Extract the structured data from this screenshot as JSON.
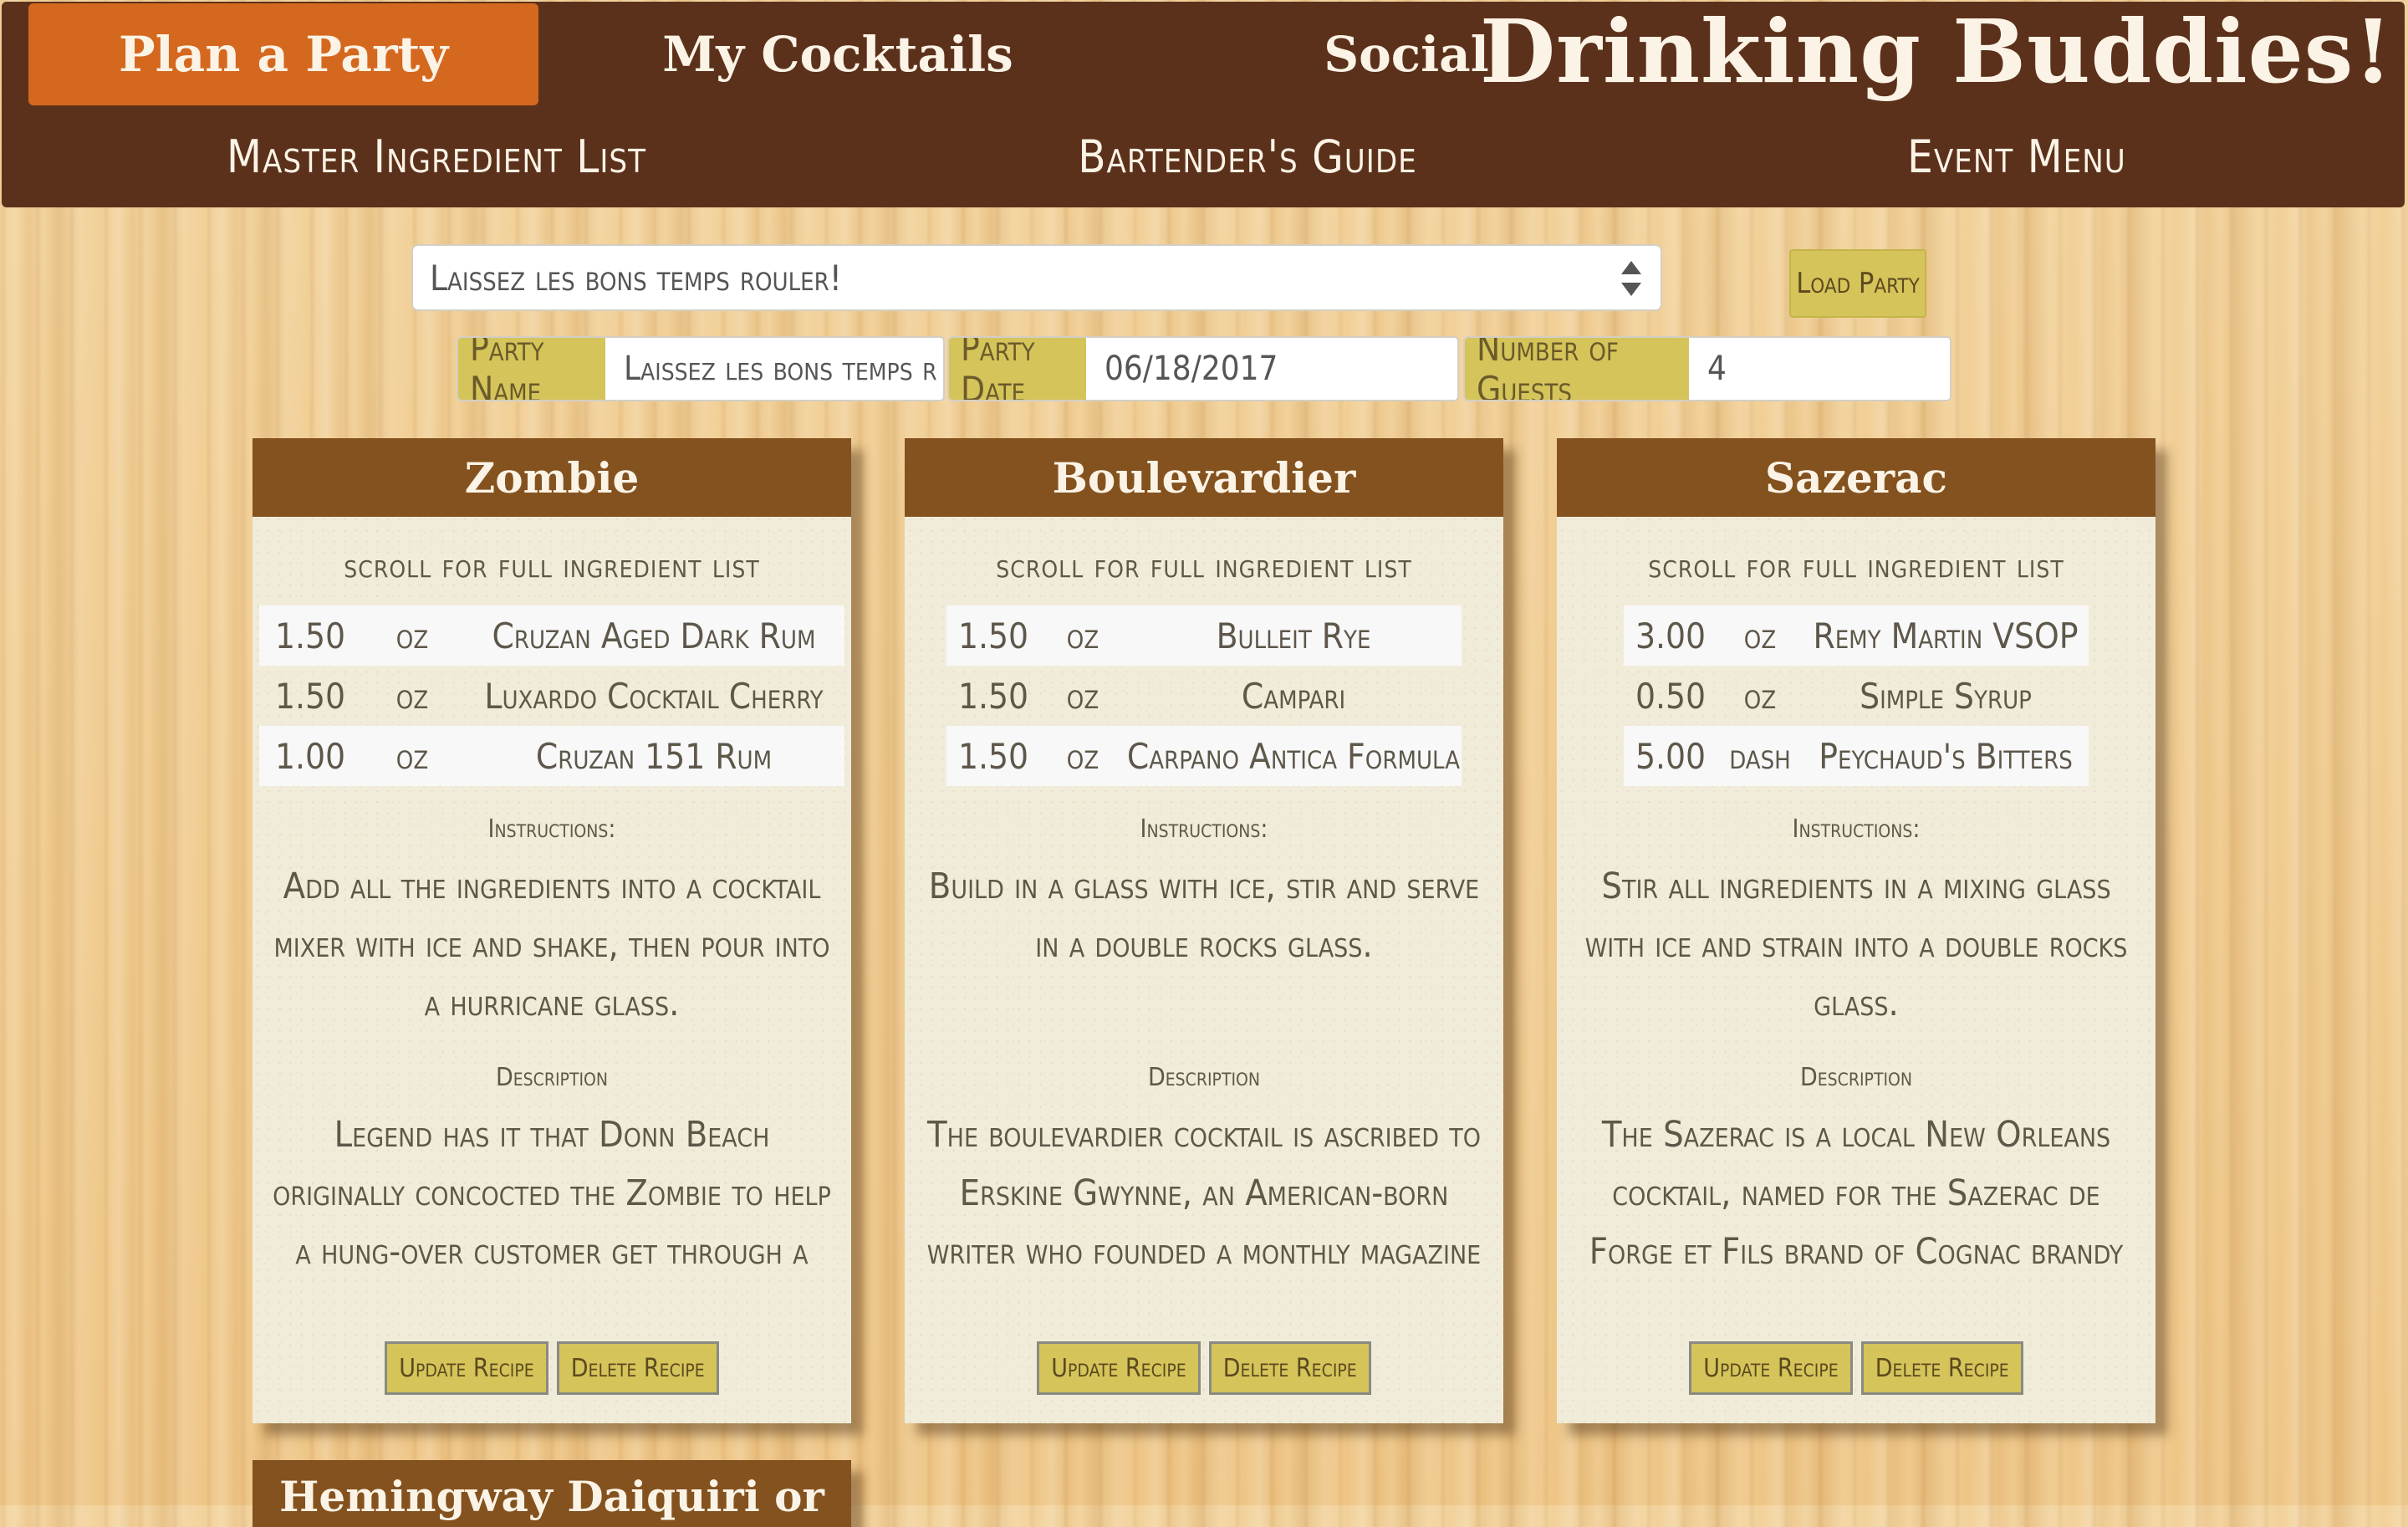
{
  "header": {
    "tabs": [
      "Plan a Party",
      "My Cocktails",
      "Social"
    ],
    "brand": "Drinking Buddies!",
    "subnav": [
      "Master Ingredient List",
      "Bartender's Guide",
      "Event Menu"
    ]
  },
  "party": {
    "selected": "Laissez les bons temps rouler!",
    "load_label": "Load Party",
    "name_label": "Party Name",
    "name_value": "Laissez les bons temps r",
    "date_label": "Party Date",
    "date_value": "06/18/2017",
    "guests_label": "Number of Guests",
    "guests_value": "4"
  },
  "cards": [
    {
      "title": "Zombie",
      "scroll_note": "scroll for full ingredient list",
      "ingredients": [
        {
          "amount": "1.50",
          "unit": "oz",
          "name": "Cruzan Aged Dark Rum"
        },
        {
          "amount": "1.50",
          "unit": "oz",
          "name": "Luxardo Cocktail Cherry"
        },
        {
          "amount": "1.00",
          "unit": "oz",
          "name": "Cruzan 151 Rum"
        }
      ],
      "instructions_label": "Instructions:",
      "instructions": "Add all the ingredients into a cocktail mixer with ice and shake, then pour into a hurricane glass.",
      "description_label": "Description",
      "description": "Legend has it that Donn Beach originally concocted the Zombie to help a hung-over customer get through a business meeting. The",
      "update_label": "Update Recipe",
      "delete_label": "Delete Recipe"
    },
    {
      "title": "Boulevardier",
      "scroll_note": "scroll for full ingredient list",
      "ingredients": [
        {
          "amount": "1.50",
          "unit": "oz",
          "name": "Bulleit Rye"
        },
        {
          "amount": "1.50",
          "unit": "oz",
          "name": "Campari"
        },
        {
          "amount": "1.50",
          "unit": "oz",
          "name": "Carpano Antica Formula"
        }
      ],
      "instructions_label": "Instructions:",
      "instructions": "Build in a glass with ice, stir and serve in a double rocks glass.",
      "description_label": "Description",
      "description": "The boulevardier cocktail is ascribed to Erskine Gwynne, an American-born writer who founded a monthly magazine in Paris called Boulevardier,",
      "update_label": "Update Recipe",
      "delete_label": "Delete Recipe"
    },
    {
      "title": "Sazerac",
      "scroll_note": "scroll for full ingredient list",
      "ingredients": [
        {
          "amount": "3.00",
          "unit": "oz",
          "name": "Remy Martin VSOP"
        },
        {
          "amount": "0.50",
          "unit": "oz",
          "name": "Simple Syrup"
        },
        {
          "amount": "5.00",
          "unit": "dash",
          "name": "Peychaud's Bitters"
        }
      ],
      "instructions_label": "Instructions:",
      "instructions": "Stir all ingredients in a mixing glass with ice and strain into a double rocks glass.",
      "description_label": "Description",
      "description": "The Sazerac is a local New Orleans cocktail, named for the Sazerac de Forge et Fils brand of Cognac brandy that served as its original main",
      "update_label": "Update Recipe",
      "delete_label": "Delete Recipe"
    },
    {
      "title": "Hemingway Daiquiri or"
    }
  ],
  "colors": {
    "header_bg": "#5c311b",
    "active_tab": "#d5681f",
    "card_head": "#84521f",
    "button": "#d4c45a",
    "card_bg": "#f1ecd9"
  }
}
